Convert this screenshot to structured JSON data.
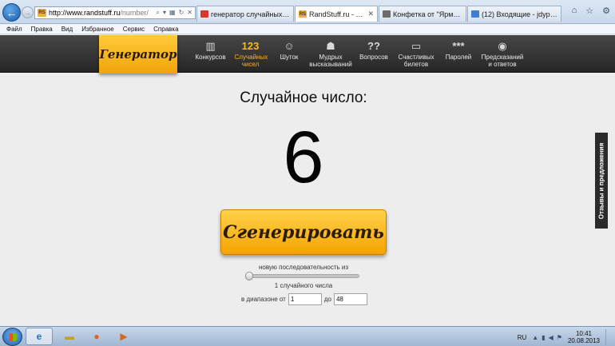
{
  "browser": {
    "address": {
      "host": "http://www.randstuff.ru",
      "path": "/number/"
    },
    "tabs": [
      {
        "label": "генератор случайных чисел ...",
        "favicon": "G",
        "active": false
      },
      {
        "label": "RandStuff.ru - генератор с...",
        "favicon": "RS",
        "active": true
      },
      {
        "label": "Конфетка от \"Ярмарки масте...",
        "favicon": "Я",
        "active": false
      },
      {
        "label": "(12) Входящие - jdypismo@m...",
        "favicon": "@",
        "active": false
      }
    ],
    "menu": [
      "Файл",
      "Правка",
      "Вид",
      "Избранное",
      "Сервис",
      "Справка"
    ]
  },
  "site": {
    "logo": "Генератор",
    "nav": [
      {
        "label": "Конкурсов",
        "icon": "gift-icon",
        "glyph": "🎁",
        "active": false
      },
      {
        "label": "Случайных чисел",
        "icon": "numbers-icon",
        "glyph": "123",
        "active": true
      },
      {
        "label": "Шуток",
        "icon": "smiley-icon",
        "glyph": "☺",
        "active": false
      },
      {
        "label": "Мудрых высказываний",
        "icon": "sage-icon",
        "glyph": "👤",
        "active": false
      },
      {
        "label": "Вопросов",
        "icon": "question-icon",
        "glyph": "??",
        "active": false
      },
      {
        "label": "Счастливых билетов",
        "icon": "ticket-icon",
        "glyph": "▭",
        "active": false
      },
      {
        "label": "Паролей",
        "icon": "password-icon",
        "glyph": "***",
        "active": false
      },
      {
        "label": "Предсказаний и ответов",
        "icon": "ball-icon",
        "glyph": "◉",
        "active": false
      }
    ]
  },
  "main": {
    "heading": "Случайное число:",
    "number": "6",
    "button_label": "Сгенерировать",
    "sequence_label": "новую последовательность из",
    "slider_value": 1,
    "count_label": "1 случайного числа",
    "range_from_label": "в диапазоне от",
    "range_from_value": "1",
    "range_to_label": "до",
    "range_to_value": "48"
  },
  "feedback_tab": "Отзывы и предложения",
  "taskbar": {
    "language": "RU",
    "time": "10:41",
    "date": "20.08.2013"
  }
}
